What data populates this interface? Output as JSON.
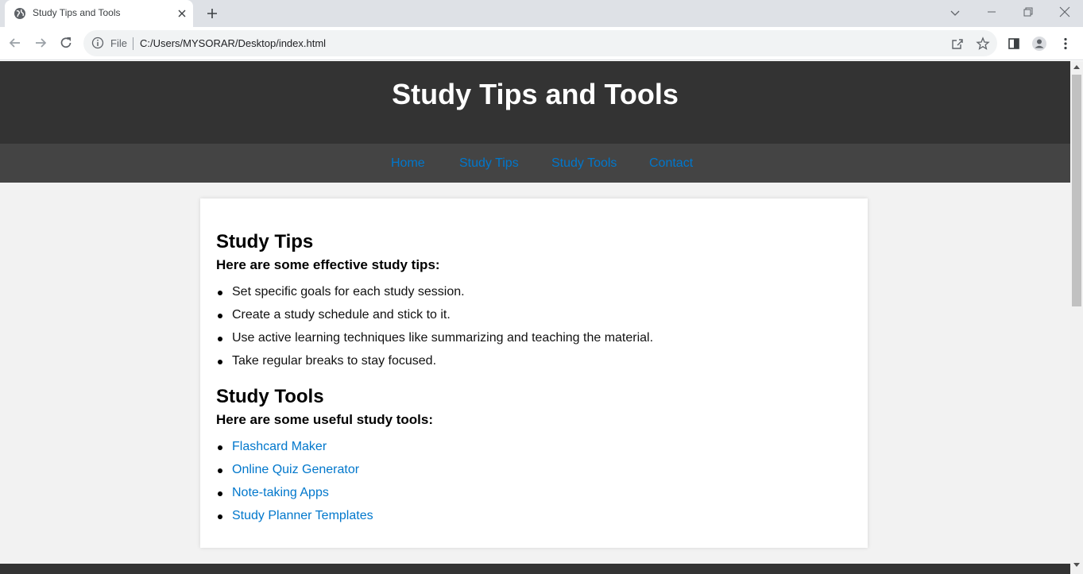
{
  "browser": {
    "tab": {
      "title": "Study Tips and Tools",
      "favicon": "globe-icon",
      "close_icon": "close-icon"
    },
    "new_tab_icon": "plus-icon",
    "window_controls": [
      "chevron-down-icon",
      "minimize-icon",
      "restore-icon",
      "close-icon"
    ],
    "toolbar": {
      "back_icon": "arrow-left-icon",
      "forward_icon": "arrow-right-icon",
      "reload_icon": "reload-icon",
      "info_icon": "info-icon",
      "scheme_label": "File",
      "url": "C:/Users/MYSORAR/Desktop/index.html",
      "share_icon": "share-icon",
      "bookmark_icon": "star-icon",
      "sidepanel_icon": "side-panel-icon",
      "profile_icon": "profile-icon",
      "menu_icon": "kebab-menu-icon"
    }
  },
  "page": {
    "header": {
      "title": "Study Tips and Tools"
    },
    "nav": [
      "Home",
      "Study Tips",
      "Study Tools",
      "Contact"
    ],
    "tips": {
      "heading": "Study Tips",
      "subheading": "Here are some effective study tips:",
      "items": [
        "Set specific goals for each study session.",
        "Create a study schedule and stick to it.",
        "Use active learning techniques like summarizing and teaching the material.",
        "Take regular breaks to stay focused."
      ]
    },
    "tools": {
      "heading": "Study Tools",
      "subheading": "Here are some useful study tools:",
      "items": [
        "Flashcard Maker",
        "Online Quiz Generator",
        "Note-taking Apps",
        "Study Planner Templates"
      ]
    }
  },
  "colors": {
    "header_bg": "#333333",
    "nav_bg": "#444444",
    "link": "#0077cc",
    "page_bg": "#f2f2f2"
  }
}
